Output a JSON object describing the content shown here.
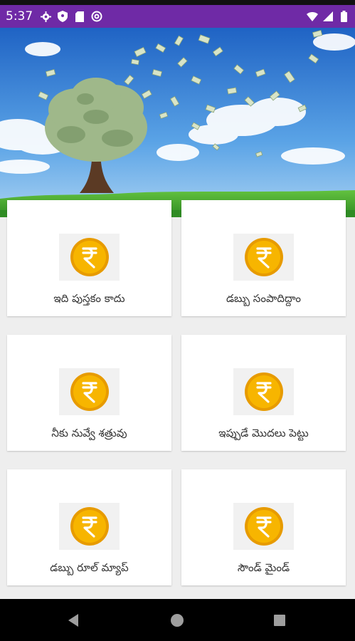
{
  "status_bar": {
    "time": "5:37",
    "background": "#6f2aa6",
    "left_icons": [
      "gear-icon",
      "shield-icon",
      "sd-card-icon",
      "at-sign-icon"
    ],
    "right_icons": [
      "wifi-icon",
      "signal-icon",
      "battery-icon"
    ]
  },
  "banner": {
    "description_icon": "money-tree-illustration"
  },
  "menu": {
    "items": [
      {
        "label": "ఇది పుస్తకం కాదు",
        "icon": "rupee-coin-icon"
      },
      {
        "label": "డబ్బు సంపాదిద్దాం",
        "icon": "rupee-coin-icon"
      },
      {
        "label": "నీకు నువ్వే శత్రువు",
        "icon": "rupee-coin-icon"
      },
      {
        "label": "ఇప్పుడే మొదలు పెట్టు",
        "icon": "rupee-coin-icon"
      },
      {
        "label": "డబ్బు రూల్ మ్యాప్",
        "icon": "rupee-coin-icon"
      },
      {
        "label": "సౌండ్ మైండ్",
        "icon": "rupee-coin-icon"
      }
    ]
  },
  "nav_bar": {
    "buttons": [
      "back-icon",
      "home-icon",
      "recents-icon"
    ]
  },
  "colors": {
    "coin": "#f5b400",
    "coin_dark": "#e08e00",
    "sky": "#3e86d4",
    "grass": "#3aa52c"
  }
}
